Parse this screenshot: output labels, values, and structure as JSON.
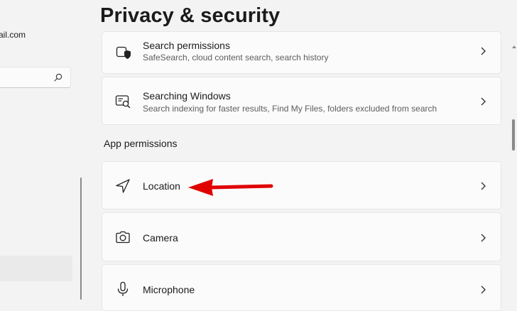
{
  "sidebar": {
    "account_email": "ail.com",
    "search": {
      "value": "",
      "placeholder": ""
    }
  },
  "page": {
    "title": "Privacy & security"
  },
  "cards_top": [
    {
      "label": "Search permissions",
      "description": "SafeSearch, cloud content search, search history",
      "icon": "shield-search-icon"
    },
    {
      "label": "Searching Windows",
      "description": "Search indexing for faster results, Find My Files, folders excluded from search",
      "icon": "search-windows-icon"
    }
  ],
  "app_permissions": {
    "heading": "App permissions",
    "items": [
      {
        "label": "Location",
        "icon": "location-icon"
      },
      {
        "label": "Camera",
        "icon": "camera-icon"
      },
      {
        "label": "Microphone",
        "icon": "microphone-icon"
      }
    ]
  },
  "annotation": {
    "arrow_color": "#e00000",
    "points_to": "Location"
  }
}
